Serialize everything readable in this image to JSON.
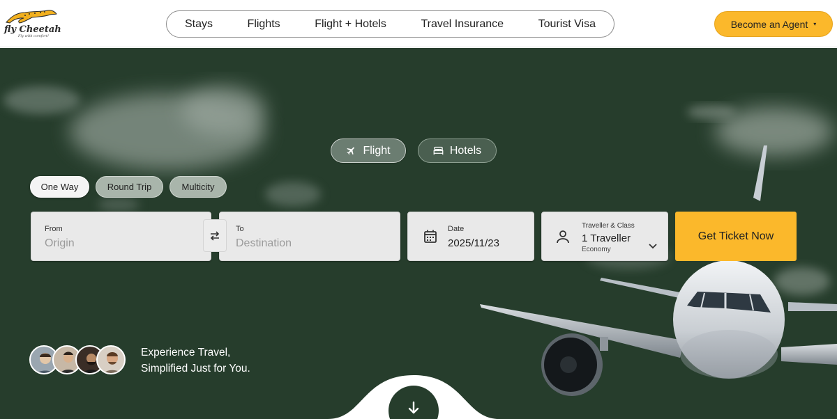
{
  "header": {
    "logo": {
      "name": "fly Cheetah",
      "tagline": "Fly with comfort!"
    },
    "nav": [
      "Stays",
      "Flights",
      "Flight + Hotels",
      "Travel Insurance",
      "Tourist Visa"
    ],
    "agent_button": "Become an Agent",
    "agent_caret": "▾"
  },
  "search": {
    "tabs": [
      {
        "label": "Flight",
        "icon": "airplane-icon",
        "active": true
      },
      {
        "label": "Hotels",
        "icon": "bed-icon",
        "active": false
      }
    ],
    "trip_types": [
      {
        "label": "One Way",
        "selected": true
      },
      {
        "label": "Round Trip",
        "selected": false
      },
      {
        "label": "Multicity",
        "selected": false
      }
    ],
    "from": {
      "label": "From",
      "placeholder": "Origin"
    },
    "to": {
      "label": "To",
      "placeholder": "Destination"
    },
    "date": {
      "label": "Date",
      "value": "2025/11/23",
      "icon": "calendar-icon"
    },
    "traveller": {
      "label": "Traveller & Class",
      "value": "1 Traveller",
      "class": "Economy",
      "icon": "person-icon"
    },
    "submit": "Get Ticket Now"
  },
  "hero": {
    "tagline_line1": "Experience Travel,",
    "tagline_line2": "Simplified Just for You."
  },
  "colors": {
    "accent": "#fbb82b",
    "hero_bg": "#263d2c",
    "field_bg": "#e9e9e9"
  }
}
